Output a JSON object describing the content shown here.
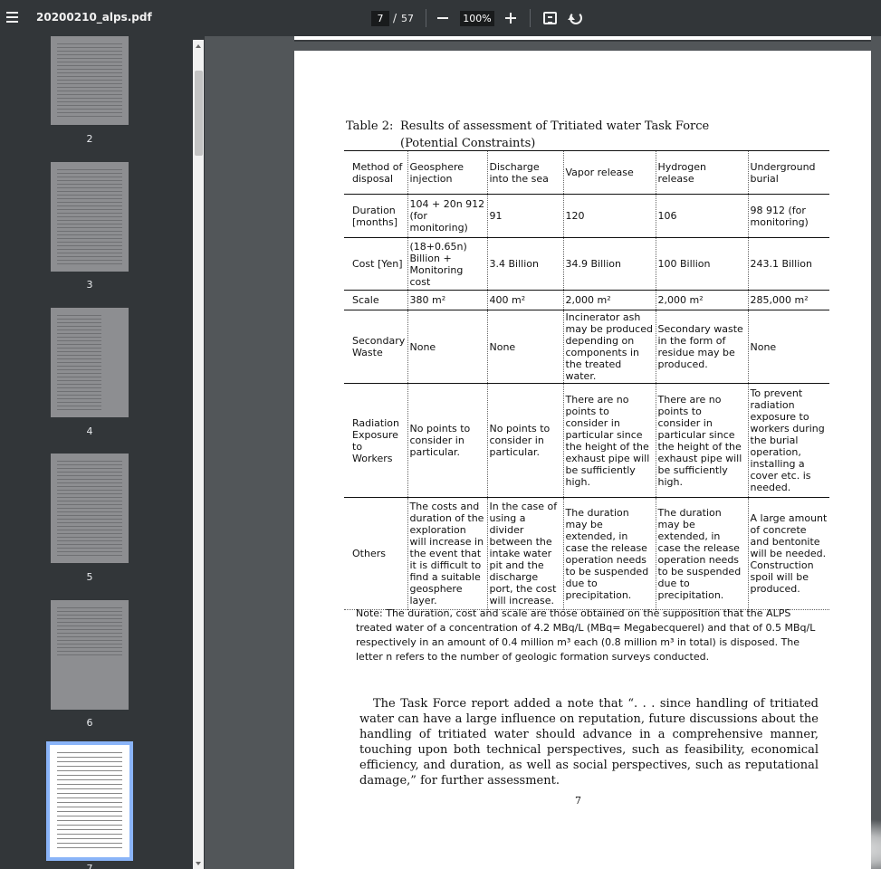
{
  "toolbar": {
    "file_name": "20200210_alps.pdf",
    "current_page": "7",
    "page_separator": "/",
    "total_pages": "57",
    "zoom": "100%"
  },
  "sidebar": {
    "thumbnails": [
      {
        "label": "2"
      },
      {
        "label": "3"
      },
      {
        "label": "4"
      },
      {
        "label": "5"
      },
      {
        "label": "6"
      },
      {
        "label": "7"
      }
    ]
  },
  "document": {
    "table_caption_label": "Table 2:",
    "table_caption_title": "Results of assessment of Tritiated water Task Force",
    "table_caption_sub": "(Potential Constraints)",
    "table": {
      "headers": [
        "Method of disposal",
        "Geosphere injection",
        "Discharge into the sea",
        "Vapor release",
        "Hydrogen release",
        "Underground burial"
      ],
      "rows": [
        {
          "label": "Duration [months]",
          "cells": [
            "104 + 20n 912 (for monitoring)",
            "91",
            "120",
            "106",
            "98  912 (for monitoring)"
          ]
        },
        {
          "label": "Cost [Yen]",
          "cells": [
            "(18+0.65n) Billion + Monitoring cost",
            "3.4 Billion",
            "34.9 Billion",
            "100 Billion",
            "243.1 Billion"
          ]
        },
        {
          "label": "Scale",
          "cells": [
            "380 m²",
            "400 m²",
            "2,000 m²",
            "2,000 m²",
            "285,000 m²"
          ]
        },
        {
          "label": "Secondary Waste",
          "cells": [
            "None",
            "None",
            "Incinerator ash may be produced depending on components in the treated water.",
            "Secondary waste in the form of residue may be produced.",
            "None"
          ]
        },
        {
          "label": "Radiation Exposure to Workers",
          "cells": [
            "No points to consider in particular.",
            "No points to consider in particular.",
            "There are no points to consider in particular since the height of the exhaust pipe will be sufficiently high.",
            "There are no points to consider in particular since the height of the exhaust pipe will be sufficiently high.",
            "To prevent radiation exposure to workers during the burial operation, installing a cover etc. is needed."
          ]
        },
        {
          "label": "Others",
          "cells": [
            "The costs and duration of the exploration will increase in the event that it is difficult to find a suitable geosphere layer.",
            "In the case of using a divider between the intake water pit and the discharge port, the cost will increase.",
            "The duration may be extended, in case the release operation needs to be suspended due to precipitation.",
            "The duration may be extended, in case the release operation needs to be suspended due to precipitation.",
            "A large amount of concrete and bentonite will be needed. Construction spoil will be produced."
          ]
        }
      ]
    },
    "note": "Note: The duration, cost and scale are those obtained on the supposition that the ALPS treated water of a concentration of 4.2 MBq/L (MBq= Megabecquerel) and that of 0.5 MBq/L respectively in an amount of 0.4 million m³ each (0.8 million m³ in total) is disposed. The letter n refers to the number of geologic formation surveys conducted.",
    "paragraph": "The Task Force report added a note that “. . . since handling of tritiated water can have a large influence on reputation, future discussions about the handling of tritiated water should advance in a comprehensive manner, touching upon both technical perspectives, such as feasibility, economical efficiency, and duration, as well as social perspectives, such as reputational damage,” for further assessment.",
    "page_number": "7"
  }
}
